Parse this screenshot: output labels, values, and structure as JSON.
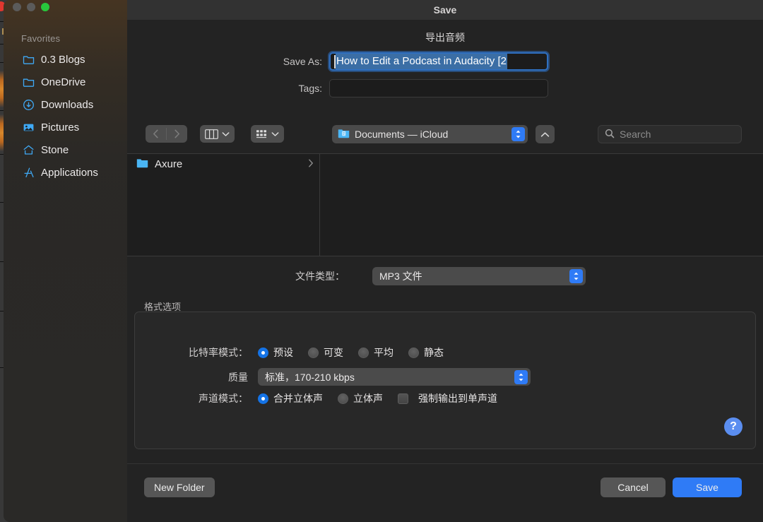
{
  "window": {
    "title": "Save",
    "traffic_lights": [
      "close",
      "minimize",
      "zoom"
    ]
  },
  "sidebar": {
    "header": "Favorites",
    "items": [
      {
        "label": "0.3 Blogs",
        "icon": "folder-icon"
      },
      {
        "label": "OneDrive",
        "icon": "folder-icon"
      },
      {
        "label": "Downloads",
        "icon": "download-circle-icon"
      },
      {
        "label": "Pictures",
        "icon": "picture-icon"
      },
      {
        "label": "Stone",
        "icon": "home-icon"
      },
      {
        "label": "Applications",
        "icon": "applications-icon"
      }
    ]
  },
  "sheet": {
    "title": "导出音频",
    "save_as_label": "Save As:",
    "save_as_value": "How to Edit a Podcast in Audacity [2",
    "tags_label": "Tags:",
    "tags_value": "",
    "tags_placeholder": ""
  },
  "toolbar": {
    "back_icon": "chevron-left-icon",
    "forward_icon": "chevron-right-icon",
    "view_mode_icon": "column-view-icon",
    "group_icon": "group-view-icon",
    "path_label": "Documents — iCloud",
    "path_icon": "documents-folder-icon",
    "up_icon": "chevron-up-icon",
    "search_placeholder": "Search",
    "search_value": "",
    "search_icon": "search-icon"
  },
  "browser": {
    "columns": [
      {
        "items": [
          {
            "label": "Axure",
            "icon": "folder-icon",
            "has_children": true
          }
        ]
      },
      {
        "items": []
      }
    ]
  },
  "filetype": {
    "label": "文件类型：",
    "value": "MP3 文件"
  },
  "format_options": {
    "group_label": "格式选项",
    "bitrate": {
      "label": "比特率模式：",
      "options": [
        {
          "label": "预设",
          "selected": true
        },
        {
          "label": "可变",
          "selected": false
        },
        {
          "label": "平均",
          "selected": false
        },
        {
          "label": "静态",
          "selected": false
        }
      ]
    },
    "quality": {
      "label": "质量",
      "value": "标准，170-210 kbps"
    },
    "channel": {
      "label": "声道模式：",
      "options": [
        {
          "label": "合并立体声",
          "selected": true
        },
        {
          "label": "立体声",
          "selected": false
        }
      ],
      "checkbox_label": "强制输出到单声道",
      "checkbox_checked": false
    },
    "help_label": "?"
  },
  "footer": {
    "new_folder_label": "New Folder",
    "cancel_label": "Cancel",
    "save_label": "Save"
  },
  "colors": {
    "accent_blue": "#2f7bf6",
    "radio_blue": "#1473e6",
    "selection_blue": "#3b6ea5",
    "zoom_green": "#28c83c",
    "folder_blue": "#3fa9f5"
  }
}
